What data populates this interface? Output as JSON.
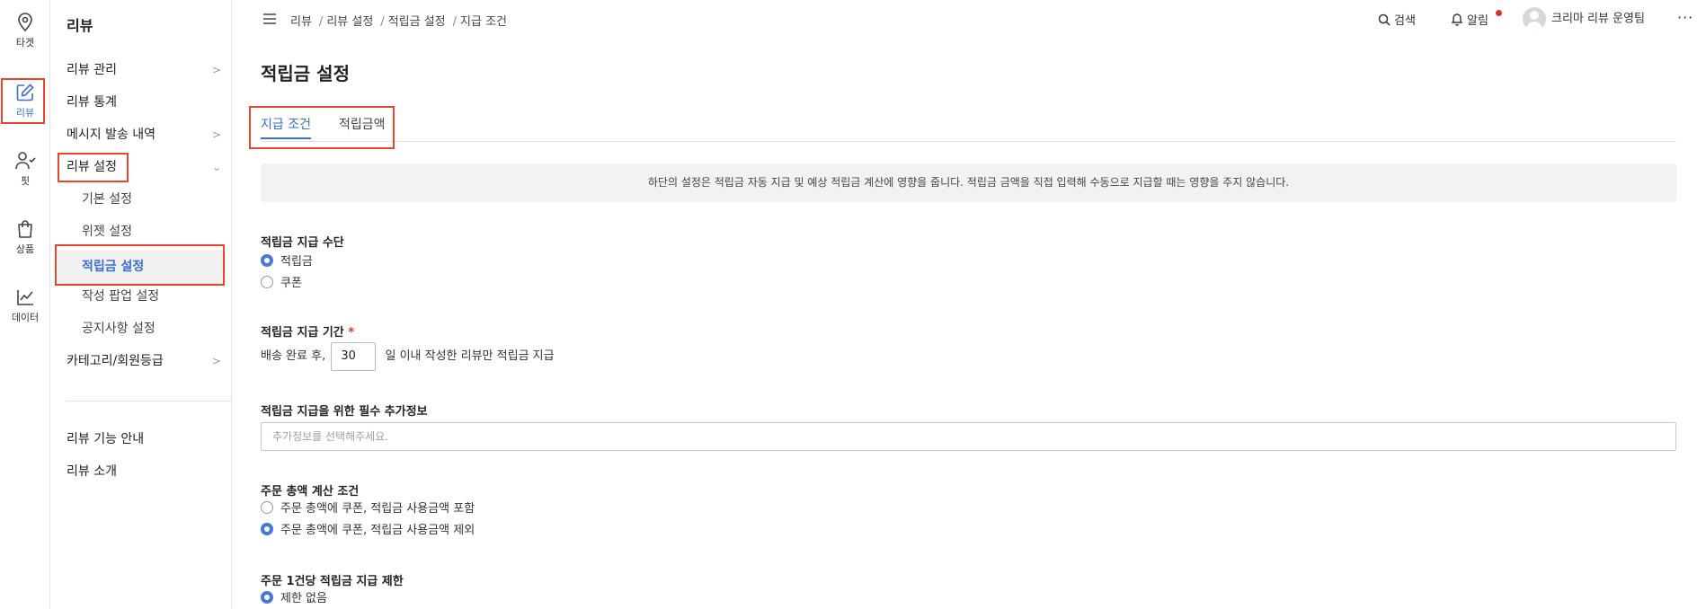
{
  "rail": {
    "items": [
      {
        "label": "타겟",
        "icon": "map-pin-icon"
      },
      {
        "label": "리뷰",
        "icon": "edit-icon",
        "active": true
      },
      {
        "label": "핏",
        "icon": "user-check-icon"
      },
      {
        "label": "상품",
        "icon": "shopping-bag-icon"
      },
      {
        "label": "데이터",
        "icon": "line-chart-icon"
      }
    ]
  },
  "menu": {
    "title": "리뷰",
    "items": [
      {
        "label": "리뷰 관리",
        "chevron": ">"
      },
      {
        "label": "리뷰 통계"
      },
      {
        "label": "메시지 발송 내역",
        "chevron": ">"
      },
      {
        "label": "리뷰 설정",
        "chevron": "⌄"
      },
      {
        "label": "기본 설정"
      },
      {
        "label": "위젯 설정"
      },
      {
        "label": "적립금 설정"
      },
      {
        "label": "작성 팝업 설정"
      },
      {
        "label": "공지사항 설정"
      },
      {
        "label": "카테고리/회원등급",
        "chevron": ">"
      },
      {
        "label": "리뷰 기능 안내"
      },
      {
        "label": "리뷰 소개"
      }
    ]
  },
  "header": {
    "breadcrumb": [
      "리뷰",
      "리뷰 설정",
      "적립금 설정",
      "지급 조건"
    ],
    "breadcrumb_sep": "/",
    "search_label": "검색",
    "alarm_label": "알림",
    "user_name": "크리마 리뷰 운영팀",
    "more": "···"
  },
  "main": {
    "page_title": "적립금 설정",
    "tabs": [
      "지급 조건",
      "적립금액"
    ],
    "notice": "하단의 설정은 적립금 자동 지급 및 예상 적립금 계산에 영향을 줍니다. 적립금 금액을 직접 입력해 수동으로 지급할 때는 영향을 주지 않습니다.",
    "payment_method": {
      "label": "적립금 지급 수단",
      "options": [
        "적립금",
        "쿠폰"
      ],
      "selected": "적립금"
    },
    "payment_period": {
      "label": "적립금 지급 기간",
      "required": "*",
      "prefix": "배송 완료 후,",
      "days": "30",
      "suffix": "일 이내 작성한 리뷰만 적립금 지급"
    },
    "extra_info": {
      "label": "적립금 지급을 위한 필수 추가정보",
      "placeholder": "추가정보를 선택해주세요."
    },
    "order_total": {
      "label": "주문 총액 계산 조건",
      "options": [
        "주문 총액에 쿠폰, 적립금 사용금액 포함",
        "주문 총액에 쿠폰, 적립금 사용금액 제외"
      ],
      "selected": "주문 총액에 쿠폰, 적립금 사용금액 제외"
    },
    "per_order_limit": {
      "label": "주문 1건당 적립금 지급 제한",
      "options": [
        "제한 없음"
      ],
      "selected": "제한 없음"
    }
  },
  "colors": {
    "accent": "#3b6fd0",
    "highlight": "#e8452c",
    "required": "#d8342a"
  }
}
